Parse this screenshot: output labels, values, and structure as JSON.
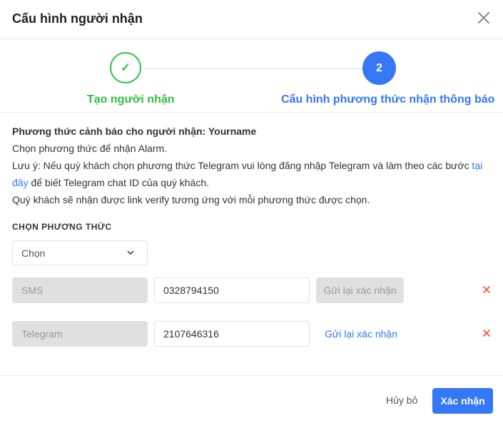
{
  "modal": {
    "title": "Cấu hình người nhận",
    "close_icon": "close-icon"
  },
  "steps": [
    {
      "label": "Tạo người nhận",
      "status": "done",
      "marker": "✓"
    },
    {
      "label": "Cấu hình phương thức nhận thông báo",
      "status": "active",
      "marker": "2"
    }
  ],
  "info": {
    "heading": "Phương thức cảnh báo cho người nhận: Yourname",
    "line1": "Chọn phương thức để nhận Alarm.",
    "line2_before": "Lưu ý: Nếu quý khách chọn phương thức Telegram vui lòng đăng nhập Telegram và làm theo các bước ",
    "line2_link": "tại đây",
    "line2_after": " để biết Telegram chat ID của quý khách.",
    "line3": "Quý khách sẽ nhận được link verify tương ứng với mỗi phương thức được chọn."
  },
  "method_section": {
    "label": "CHỌN PHƯƠNG THỨC",
    "select_value": "Chọn"
  },
  "methods": [
    {
      "type": "SMS",
      "value": "0328794150",
      "resend_label": "Gửi lại xác nhận",
      "resend_enabled": false
    },
    {
      "type": "Telegram",
      "value": "2107646316",
      "resend_label": "Gửi lại xác nhận",
      "resend_enabled": true
    }
  ],
  "footer": {
    "cancel_label": "Hủy bỏ",
    "confirm_label": "Xác nhận"
  },
  "colors": {
    "accent": "#3478f6",
    "success": "#2fbf3f",
    "danger": "#f5522d"
  }
}
